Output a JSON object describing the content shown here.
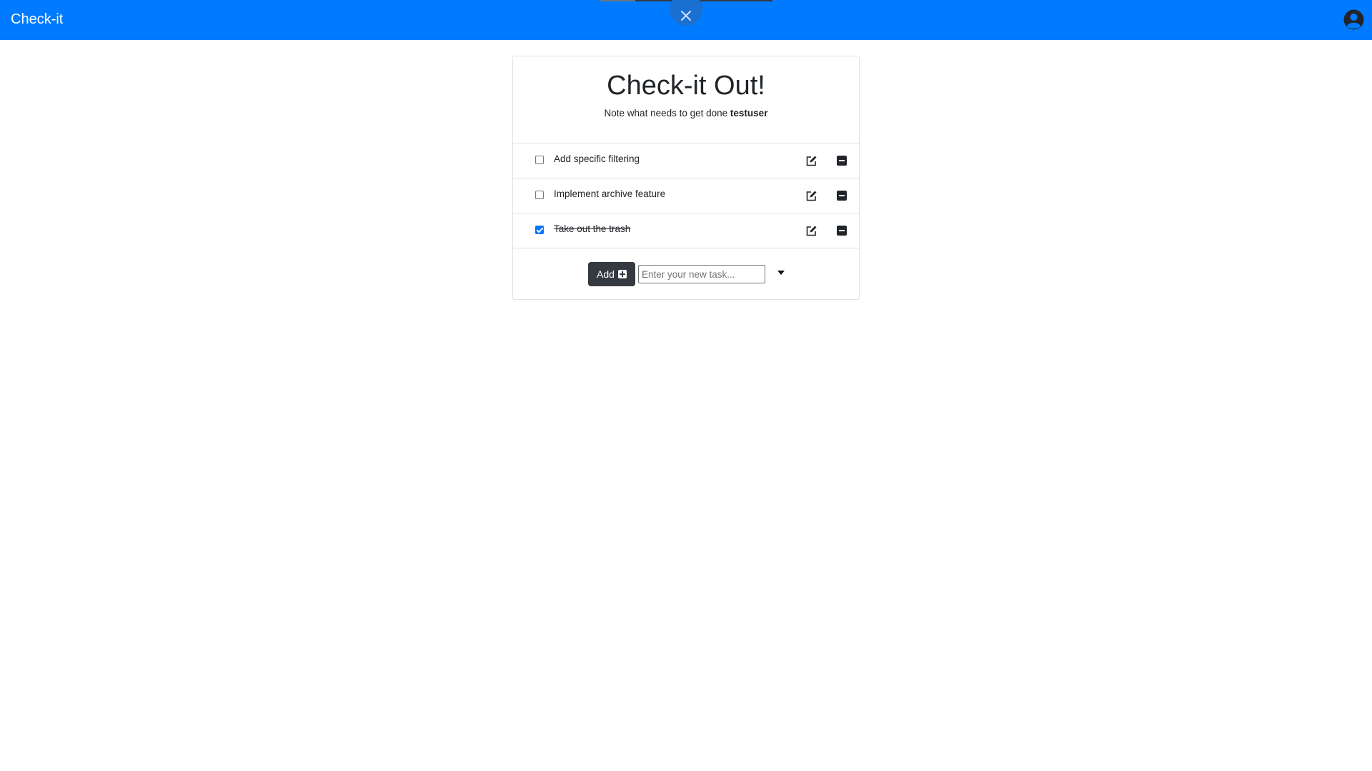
{
  "navbar": {
    "brand": "Check-it",
    "color": "#007bff",
    "close_icon": "close-icon",
    "user_icon": "user-circle-icon"
  },
  "card": {
    "title": "Check-it Out!",
    "subtitle_prefix": "Note what needs to get done ",
    "username": "testuser"
  },
  "tasks": [
    {
      "text": "Add specific filtering",
      "completed": false
    },
    {
      "text": "Implement archive feature",
      "completed": false
    },
    {
      "text": "Take out the trash",
      "completed": true
    }
  ],
  "task_actions": {
    "edit_icon": "edit-icon",
    "remove_icon": "minus-square-icon"
  },
  "add_form": {
    "button_label": "Add",
    "button_icon": "plus-square-icon",
    "input_placeholder": "Enter your new task...",
    "input_value": "",
    "dropdown_icon": "caret-down-icon"
  }
}
